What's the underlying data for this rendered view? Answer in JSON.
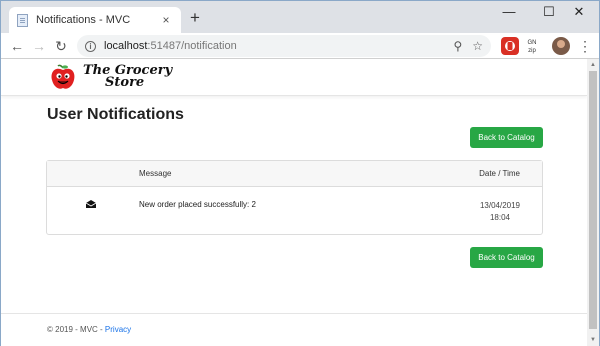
{
  "browser": {
    "tab_title": "Notifications - MVC",
    "tab_close": "×",
    "new_tab": "+",
    "minimize": "—",
    "maximize": "☐",
    "close": "✕",
    "url_host": "localhost",
    "url_path": ":51487/notification",
    "ext_red_label": "⬤",
    "ext_gh_line1": "GN",
    "ext_gh_line2": "zip"
  },
  "site": {
    "logo_line1": "The Grocery",
    "logo_line2": "Store"
  },
  "page": {
    "title": "User Notifications",
    "back_button_top": "Back to Catalog",
    "back_button_bottom": "Back to Catalog"
  },
  "table": {
    "headers": {
      "message": "Message",
      "date": "Date / Time"
    },
    "rows": [
      {
        "message": "New order placed successfully: 2",
        "date": "13/04/2019",
        "time": "18:04",
        "icon": "envelope-icon"
      }
    ]
  },
  "footer": {
    "text": "© 2019 - MVC - ",
    "privacy": "Privacy"
  },
  "colors": {
    "accent": "#28a745",
    "link": "#1a73e8"
  }
}
